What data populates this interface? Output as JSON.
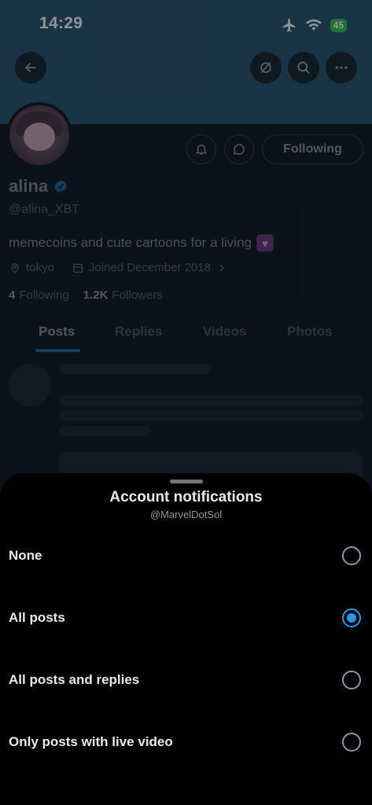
{
  "status_bar": {
    "time": "14:29",
    "battery": "45"
  },
  "header": {
    "back_icon": "arrow-left-icon",
    "actions": [
      "no-sync-icon",
      "search-icon",
      "more-icon"
    ]
  },
  "profile": {
    "name": "alina",
    "handle": "@alina_XBT",
    "bio": "memecoins and cute cartoons for a living",
    "location": "tokyo",
    "joined": "Joined December 2018",
    "following_count": "4",
    "following_label": "Following",
    "followers_count": "1.2K",
    "followers_label": "Followers",
    "follow_button": "Following",
    "verified_color": "#1d9bf0"
  },
  "tabs": [
    {
      "label": "Posts",
      "active": true
    },
    {
      "label": "Replies",
      "active": false
    },
    {
      "label": "Videos",
      "active": false
    },
    {
      "label": "Photos",
      "active": false
    }
  ],
  "sheet": {
    "title": "Account notifications",
    "subtitle": "@MarvelDotSol",
    "options": [
      {
        "label": "None",
        "selected": false
      },
      {
        "label": "All posts",
        "selected": true
      },
      {
        "label": "All posts and replies",
        "selected": false
      },
      {
        "label": "Only posts with live video",
        "selected": false
      }
    ],
    "accent": "#1d9bf0"
  }
}
